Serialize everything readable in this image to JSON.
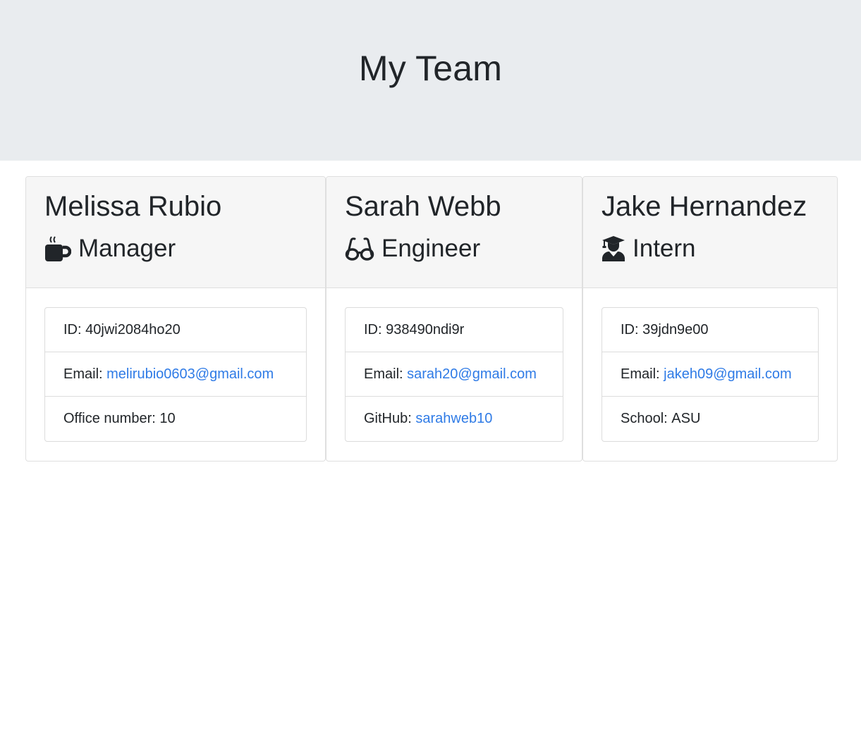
{
  "header": {
    "title": "My Team"
  },
  "cards": [
    {
      "name": "Melissa Rubio",
      "role": "Manager",
      "role_icon": "coffee-mug-icon",
      "rows": [
        {
          "label": "ID:",
          "value": "40jwi2084ho20"
        },
        {
          "label": "Email:",
          "value": "melirubio0603@gmail.com"
        },
        {
          "label": "Office number:",
          "value": "10"
        }
      ]
    },
    {
      "name": "Sarah Webb",
      "role": "Engineer",
      "role_icon": "glasses-icon",
      "rows": [
        {
          "label": "ID:",
          "value": "938490ndi9r"
        },
        {
          "label": "Email:",
          "value": "sarah20@gmail.com"
        },
        {
          "label": "GitHub:",
          "value": "sarahweb10"
        }
      ]
    },
    {
      "name": "Jake Hernandez",
      "role": "Intern",
      "role_icon": "graduate-icon",
      "rows": [
        {
          "label": "ID:",
          "value": "39jdn9e00"
        },
        {
          "label": "Email:",
          "value": "jakeh09@gmail.com"
        },
        {
          "label": "School:",
          "value": "ASU"
        }
      ]
    }
  ],
  "colors": {
    "link": "#2f7be6",
    "jumbotron": "#e9ecef",
    "card_header": "#f6f6f6"
  }
}
